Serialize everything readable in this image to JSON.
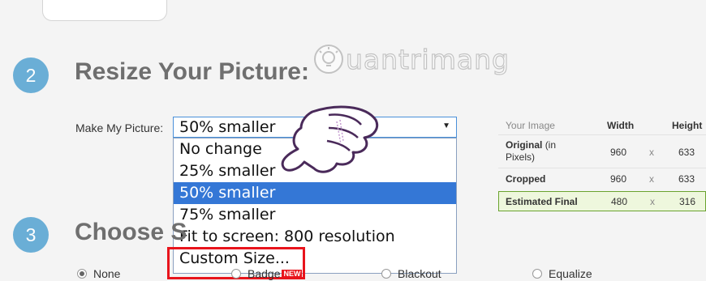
{
  "steps": [
    {
      "number": "2",
      "title": "Resize Your Picture:"
    },
    {
      "number": "3",
      "title": "Choose S"
    }
  ],
  "watermark": {
    "text": "uantrimang"
  },
  "resize": {
    "label": "Make My Picture:",
    "selected_value": "50% smaller",
    "options": [
      {
        "label": "No change",
        "selected": false
      },
      {
        "label": "25% smaller",
        "selected": false
      },
      {
        "label": "50% smaller",
        "selected": true
      },
      {
        "label": "75% smaller",
        "selected": false
      },
      {
        "label": "Fit to screen: 800 resolution",
        "selected": false
      },
      {
        "label": "Custom Size...",
        "selected": false
      }
    ]
  },
  "image_table": {
    "headers": [
      "Your Image",
      "Width",
      "",
      "Height"
    ],
    "original": {
      "label": "Original",
      "label_suffix": "(in Pixels)",
      "width": "960",
      "sep": "x",
      "height": "633"
    },
    "cropped": {
      "label": "Cropped",
      "width": "960",
      "sep": "x",
      "height": "633"
    },
    "final": {
      "label": "Estimated Final",
      "width": "480",
      "sep": "x",
      "height": "316"
    }
  },
  "effects": {
    "options": [
      {
        "label": "None",
        "checked": true
      },
      {
        "label": "Badge",
        "badge": "NEW",
        "checked": false
      },
      {
        "label": "Blackout",
        "checked": false
      },
      {
        "label": "Equalize",
        "checked": false
      }
    ]
  },
  "colors": {
    "accent": "#6aaed6",
    "select_highlight": "#3477d6",
    "annotation": "#e8141c",
    "final_row_border": "#6aa32e"
  }
}
